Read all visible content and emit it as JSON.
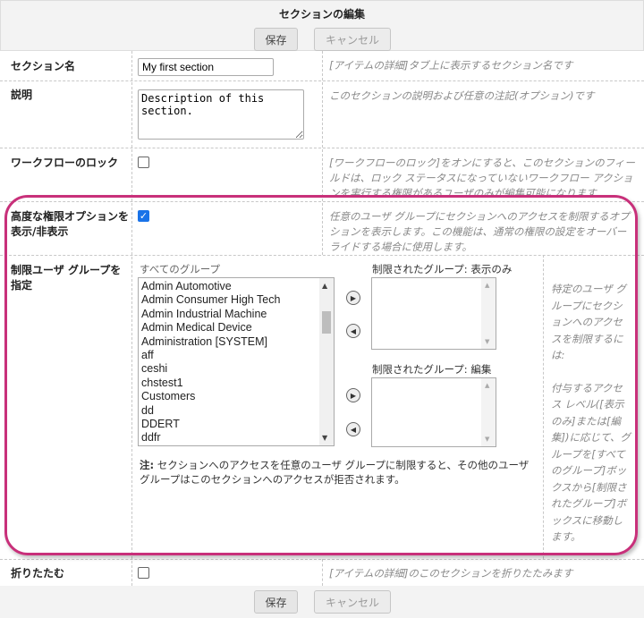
{
  "title": "セクションの編集",
  "buttons": {
    "save": "保存",
    "cancel": "キャンセル"
  },
  "rows": {
    "name": {
      "label": "セクション名",
      "value": "My first section",
      "help": "[アイテムの詳細]タブ上に表示するセクション名です"
    },
    "desc": {
      "label": "説明",
      "value": "Description of this section.",
      "help": "このセクションの説明および任意の注記(オプション)です"
    },
    "lock": {
      "label": "ワークフローのロック",
      "checked": false,
      "help": "[ワークフローのロック]をオンにすると、このセクションのフィールドは、ロック ステータスになっていないワークフロー アクションを実行する権限があるユーザのみが編集可能になります"
    },
    "advanced": {
      "label": "高度な権限オプションを表示/非表示",
      "checked": true,
      "help": "任意のユーザ グループにセクションへのアクセスを制限するオプションを表示します。この機能は、通常の権限の設定をオーバーライドする場合に使用します。"
    },
    "restrict": {
      "label": "制限ユーザ グループを指定",
      "all_groups_label": "すべてのグループ",
      "all_groups": [
        "Admin Automotive",
        "Admin Consumer High Tech",
        "Admin Industrial Machine",
        "Admin Medical Device",
        "Administration [SYSTEM]",
        "aff",
        "ceshi",
        "chstest1",
        "Customers",
        "dd",
        "DDERT",
        "ddfr"
      ],
      "view_label": "制限されたグループ: 表示のみ",
      "edit_label": "制限されたグループ: 編集",
      "note_bold": "注:",
      "note": "セクションへのアクセスを任意のユーザ グループに制限すると、その他のユーザ グループはこのセクションへのアクセスが拒否されます。",
      "help": "特定のユーザ グループにセクションへのアクセスを制限するには:",
      "help2": "付与するアクセス レベル([表示のみ]または[編集])に応じて、グループを[すべてのグループ]ボックスから[制限されたグループ]ボックスに移動します。"
    },
    "collapse": {
      "label": "折りたたむ",
      "checked": false,
      "help": "[アイテムの詳細]のこのセクションを折りたたみます"
    }
  },
  "highlight_color": "#c8307a"
}
